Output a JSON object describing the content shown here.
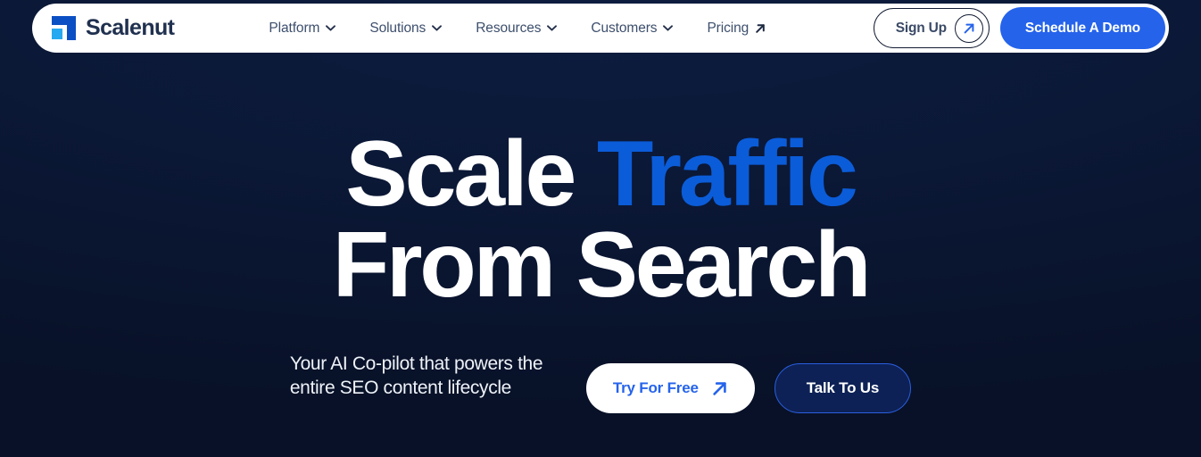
{
  "brand": {
    "name": "Scalenut",
    "logo_icon": "scalenut-logo-icon",
    "mark_primary_color": "#0B4FC4",
    "mark_accent_color": "#26A9F0"
  },
  "nav": {
    "items": [
      {
        "label": "Platform",
        "icon": "chevron-down-icon"
      },
      {
        "label": "Solutions",
        "icon": "chevron-down-icon"
      },
      {
        "label": "Resources",
        "icon": "chevron-down-icon"
      },
      {
        "label": "Customers",
        "icon": "chevron-down-icon"
      },
      {
        "label": "Pricing",
        "icon": "arrow-up-right-icon"
      }
    ],
    "sign_up": {
      "label": "Sign Up",
      "icon": "arrow-up-right-icon"
    },
    "schedule_demo": {
      "label": "Schedule A Demo",
      "color": "#2563EB"
    }
  },
  "hero": {
    "title_line1_white": "Scale ",
    "title_line1_accent": "Traffic",
    "title_line2": "From Search",
    "accent_color": "#0B5CD8",
    "subtitle": "Your AI Co-pilot that powers the entire SEO content lifecycle",
    "cta_primary": {
      "label": "Try For Free",
      "icon": "arrow-up-right-icon",
      "text_color": "#2563EB"
    },
    "cta_secondary": {
      "label": "Talk To Us",
      "border_color": "#2B5FE0"
    }
  },
  "background": {
    "color": "#0b1836"
  }
}
